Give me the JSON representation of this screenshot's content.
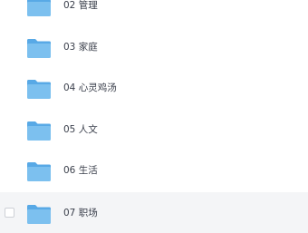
{
  "file_list": {
    "items": [
      {
        "label": "02 管理",
        "icon": "folder-icon",
        "hovered": false
      },
      {
        "label": "03 家庭",
        "icon": "folder-icon",
        "hovered": false
      },
      {
        "label": "04 心灵鸡汤",
        "icon": "folder-icon",
        "hovered": false
      },
      {
        "label": "05 人文",
        "icon": "folder-icon",
        "hovered": false
      },
      {
        "label": "06 生活",
        "icon": "folder-icon",
        "hovered": false
      },
      {
        "label": "07 职场",
        "icon": "folder-icon",
        "hovered": true
      }
    ],
    "colors": {
      "folder_front": "#7cc0ef",
      "folder_back": "#58a9e6",
      "hover_background": "#f4f5f7",
      "label_text": "#3a3f4b"
    }
  }
}
